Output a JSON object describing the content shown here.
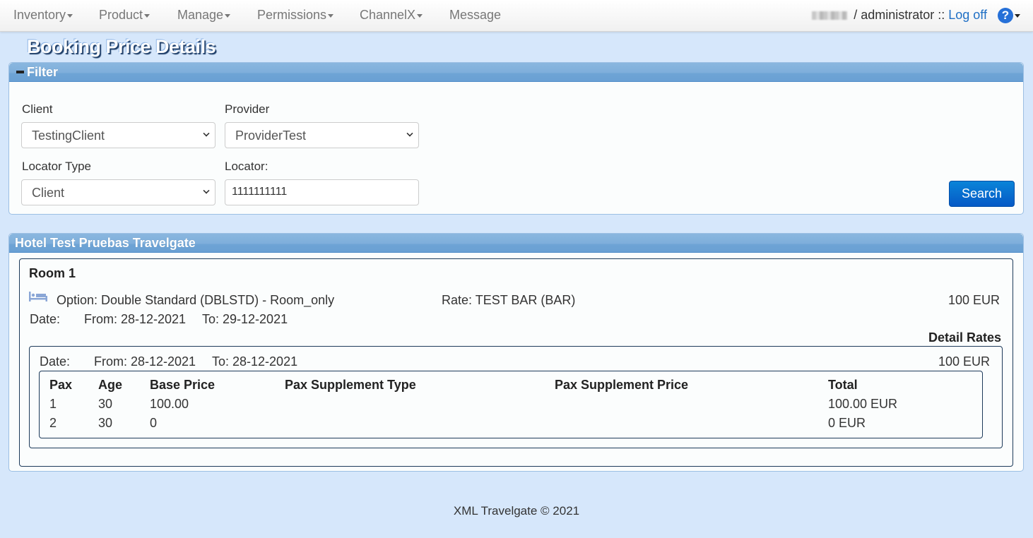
{
  "nav": {
    "items": [
      {
        "label": "Inventory",
        "dropdown": true
      },
      {
        "label": "Product",
        "dropdown": true
      },
      {
        "label": "Manage",
        "dropdown": true
      },
      {
        "label": "Permissions",
        "dropdown": true
      },
      {
        "label": "ChannelX",
        "dropdown": true
      },
      {
        "label": "Message",
        "dropdown": false
      }
    ],
    "user_role": "/ administrator ::",
    "logoff_label": "Log off",
    "help_glyph": "?"
  },
  "page": {
    "title": "Booking Price Details"
  },
  "filter": {
    "title": "Filter",
    "client_label": "Client",
    "client_value": "TestingClient",
    "provider_label": "Provider",
    "provider_value": "ProviderTest",
    "locator_type_label": "Locator Type",
    "locator_type_value": "Client",
    "locator_label": "Locator:",
    "locator_value": "1111111111",
    "search_label": "Search"
  },
  "hotel": {
    "name": "Hotel Test Pruebas Travelgate",
    "room": {
      "title": "Room 1",
      "option": "Option: Double Standard (DBLSTD) - Room_only",
      "rate": "Rate: TEST BAR (BAR)",
      "price": "100 EUR",
      "date_label": "Date:",
      "date_from": "From: 28-12-2021",
      "date_to": "To: 29-12-2021",
      "detail_rates_label": "Detail Rates",
      "detail": {
        "date_label": "Date:",
        "date_from": "From: 28-12-2021",
        "date_to": "To: 28-12-2021",
        "price": "100 EUR",
        "columns": [
          "Pax",
          "Age",
          "Base Price",
          "Pax Supplement Type",
          "Pax Supplement Price",
          "Total"
        ],
        "rows": [
          {
            "pax": "1",
            "age": "30",
            "base_price": "100.00",
            "supplement_type": "",
            "supplement_price": "",
            "total": "100.00 EUR"
          },
          {
            "pax": "2",
            "age": "30",
            "base_price": "0",
            "supplement_type": "",
            "supplement_price": "",
            "total": "0 EUR"
          }
        ]
      }
    }
  },
  "footer": {
    "text": "XML Travelgate © 2021"
  }
}
